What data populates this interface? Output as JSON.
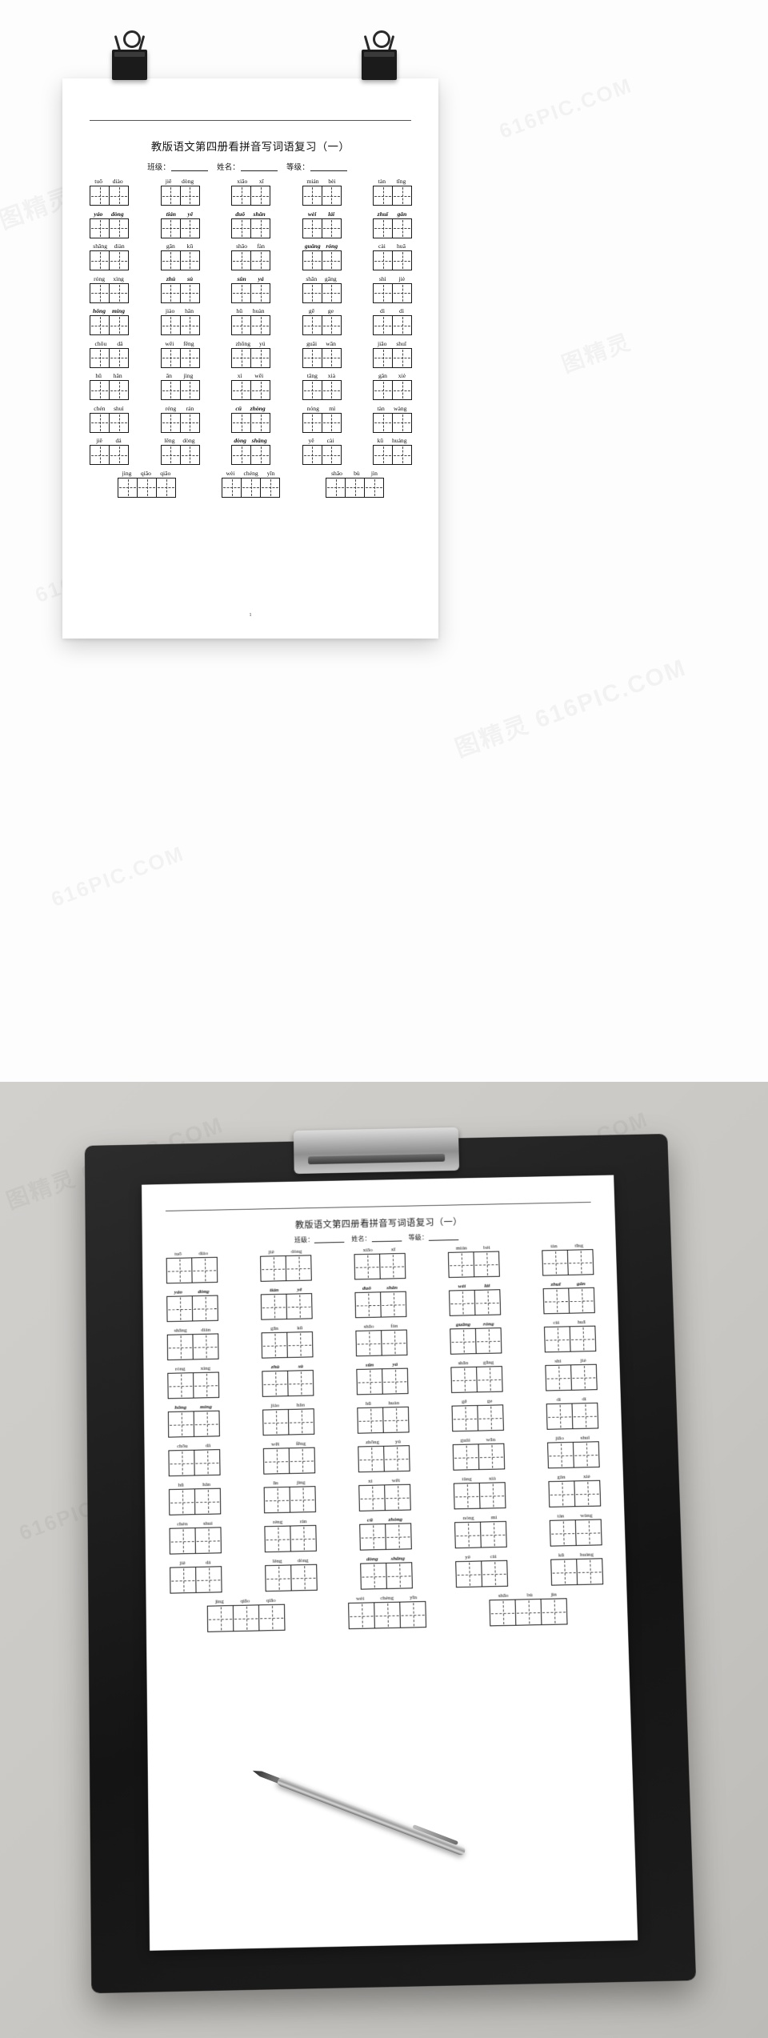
{
  "document": {
    "title": "教版语文第四册看拼音写词语复习（一）",
    "meta": {
      "class_label": "班级：",
      "name_label": "姓名：",
      "grade_label": "等级："
    },
    "page_number": "1"
  },
  "watermarks": [
    "图精灵 616PIC.COM",
    "616PIC.COM",
    "图精灵",
    "616PIC.COM",
    "图精灵 616PIC.COM",
    "616PIC.COM"
  ],
  "exercise": {
    "rows": [
      {
        "groups": [
          {
            "pinyin": [
              "tuō",
              "diào"
            ],
            "cells": 2,
            "bold": false
          },
          {
            "pinyin": [
              "jiě",
              "dòng"
            ],
            "cells": 2,
            "bold": false
          },
          {
            "pinyin": [
              "xiāo",
              "xī"
            ],
            "cells": 2,
            "bold": false
          },
          {
            "pinyin": [
              "mián",
              "bèi"
            ],
            "cells": 2,
            "bold": false
          },
          {
            "pinyin": [
              "tàn",
              "tīng"
            ],
            "cells": 2,
            "bold": false
          }
        ]
      },
      {
        "groups": [
          {
            "pinyin": [
              "yáo",
              "dòng"
            ],
            "cells": 2,
            "bold": true
          },
          {
            "pinyin": [
              "tián",
              "yě"
            ],
            "cells": 2,
            "bold": true
          },
          {
            "pinyin": [
              "duǒ",
              "shǎn"
            ],
            "cells": 2,
            "bold": true
          },
          {
            "pinyin": [
              "wèi",
              "lái"
            ],
            "cells": 2,
            "bold": true
          },
          {
            "pinyin": [
              "zhuī",
              "gǎn"
            ],
            "cells": 2,
            "bold": true
          }
        ]
      },
      {
        "groups": [
          {
            "pinyin": [
              "shāng",
              "diàn"
            ],
            "cells": 2,
            "bold": false
          },
          {
            "pinyin": [
              "gān",
              "kū"
            ],
            "cells": 2,
            "bold": false
          },
          {
            "pinyin": [
              "shāo",
              "fàn"
            ],
            "cells": 2,
            "bold": false
          },
          {
            "pinyin": [
              "guāng",
              "róng"
            ],
            "cells": 2,
            "bold": true
          },
          {
            "pinyin": [
              "cài",
              "huā"
            ],
            "cells": 2,
            "bold": false
          }
        ]
      },
      {
        "groups": [
          {
            "pinyin": [
              "róng",
              "xìng"
            ],
            "cells": 2,
            "bold": false
          },
          {
            "pinyin": [
              "zhù",
              "sù"
            ],
            "cells": 2,
            "bold": true
          },
          {
            "pinyin": [
              "sǔn",
              "yá"
            ],
            "cells": 2,
            "bold": true
          },
          {
            "pinyin": [
              "shān",
              "gāng"
            ],
            "cells": 2,
            "bold": false
          },
          {
            "pinyin": [
              "shì",
              "jiè"
            ],
            "cells": 2,
            "bold": false
          }
        ]
      },
      {
        "groups": [
          {
            "pinyin": [
              "hōng",
              "míng"
            ],
            "cells": 2,
            "bold": true
          },
          {
            "pinyin": [
              "jiào",
              "hǎn"
            ],
            "cells": 2,
            "bold": false
          },
          {
            "pinyin": [
              "hū",
              "huàn"
            ],
            "cells": 2,
            "bold": false
          },
          {
            "pinyin": [
              "gē",
              "ge"
            ],
            "cells": 2,
            "bold": false
          },
          {
            "pinyin": [
              "dì",
              "dì"
            ],
            "cells": 2,
            "bold": false
          }
        ]
      },
      {
        "groups": [
          {
            "pinyin": [
              "chōu",
              "dǎ"
            ],
            "cells": 2,
            "bold": false
          },
          {
            "pinyin": [
              "wēi",
              "fēng"
            ],
            "cells": 2,
            "bold": false
          },
          {
            "pinyin": [
              "zhōng",
              "yú"
            ],
            "cells": 2,
            "bold": false
          },
          {
            "pinyin": [
              "guǎi",
              "wān"
            ],
            "cells": 2,
            "bold": false
          },
          {
            "pinyin": [
              "jiāo",
              "shuǐ"
            ],
            "cells": 2,
            "bold": false
          }
        ]
      },
      {
        "groups": [
          {
            "pinyin": [
              "hū",
              "hǎn"
            ],
            "cells": 2,
            "bold": false
          },
          {
            "pinyin": [
              "ān",
              "jìng"
            ],
            "cells": 2,
            "bold": false
          },
          {
            "pinyin": [
              "xì",
              "wēi"
            ],
            "cells": 2,
            "bold": false
          },
          {
            "pinyin": [
              "tǎng",
              "xià"
            ],
            "cells": 2,
            "bold": false
          },
          {
            "pinyin": [
              "gǎn",
              "xiè"
            ],
            "cells": 2,
            "bold": false
          }
        ]
      },
      {
        "groups": [
          {
            "pinyin": [
              "chén",
              "shuì"
            ],
            "cells": 2,
            "bold": false
          },
          {
            "pinyin": [
              "réng",
              "rán"
            ],
            "cells": 2,
            "bold": false
          },
          {
            "pinyin": [
              "cū",
              "zhòng"
            ],
            "cells": 2,
            "bold": true
          },
          {
            "pinyin": [
              "nóng",
              "mì"
            ],
            "cells": 2,
            "bold": false
          },
          {
            "pinyin": [
              "tàn",
              "wàng"
            ],
            "cells": 2,
            "bold": false
          }
        ]
      },
      {
        "groups": [
          {
            "pinyin": [
              "jiě",
              "dá"
            ],
            "cells": 2,
            "bold": false
          },
          {
            "pinyin": [
              "lěng",
              "dòng"
            ],
            "cells": 2,
            "bold": false
          },
          {
            "pinyin": [
              "dòng",
              "shāng"
            ],
            "cells": 2,
            "bold": true
          },
          {
            "pinyin": [
              "yě",
              "cài"
            ],
            "cells": 2,
            "bold": false
          },
          {
            "pinyin": [
              "kū",
              "huáng"
            ],
            "cells": 2,
            "bold": false
          }
        ]
      },
      {
        "final": true,
        "groups": [
          {
            "pinyin": [
              "jìng",
              "qiāo",
              "qiāo"
            ],
            "cells": 3,
            "bold": false
          },
          {
            "pinyin": [
              "wèi",
              "chéng",
              "yīn"
            ],
            "cells": 3,
            "bold": false
          },
          {
            "pinyin": [
              "shāo",
              "bù",
              "jìn"
            ],
            "cells": 3,
            "bold": false
          }
        ]
      }
    ]
  }
}
